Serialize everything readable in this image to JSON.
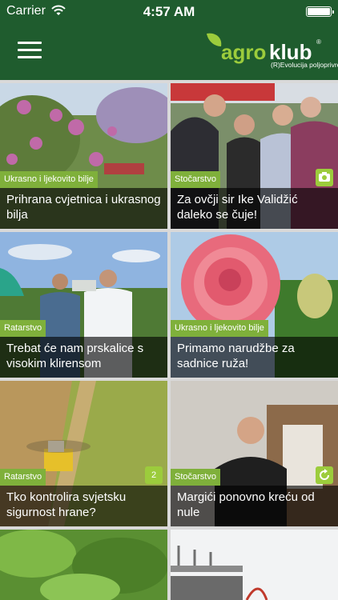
{
  "status_bar": {
    "carrier": "Carrier",
    "time": "4:57 AM"
  },
  "header": {
    "logo_agro": "agro",
    "logo_klub": "klub",
    "logo_reg": "®",
    "tagline": "(R)Evolucija poljoprivrede"
  },
  "colors": {
    "header_bg": "#1f5c2e",
    "accent": "#7fb03b",
    "logo_green": "#9ccc3c"
  },
  "articles": [
    {
      "category": "Ukrasno i ljekovito bilje",
      "title": "Prihrana cvjetnica i ukrasnog bilja",
      "badge": ""
    },
    {
      "category": "Stočarstvo",
      "title": "Za ovčji sir Ike Validžić daleko se čuje!",
      "badge": "camera-icon"
    },
    {
      "category": "Ratarstvo",
      "title": "Trebat će nam prskalice s visokim klirensom",
      "badge": ""
    },
    {
      "category": "Ukrasno i ljekovito bilje",
      "title": "Primamo narudžbe za sadnice ruža!",
      "badge": ""
    },
    {
      "category": "Ratarstvo",
      "title": "Tko kontrolira svjetsku sigurnost hrane?",
      "badge": "2"
    },
    {
      "category": "Stočarstvo",
      "title": "Margići ponovno kreću od nule",
      "badge": "refresh-icon"
    }
  ]
}
